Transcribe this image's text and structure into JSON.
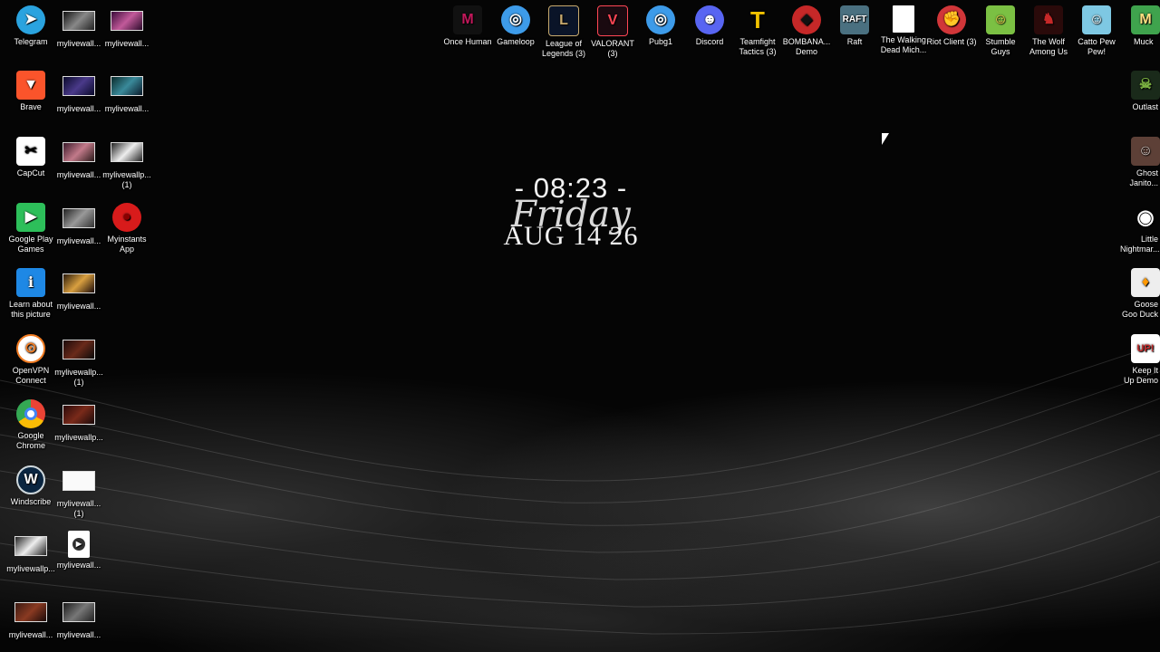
{
  "clock": {
    "time": "- 08:23 -",
    "day": "Friday",
    "date": "AUG 14 26"
  },
  "left_col1": [
    {
      "label": "Telegram",
      "icon": "telegram-icon",
      "color": "#2aa3df"
    },
    {
      "label": "Brave",
      "icon": "brave-lion-icon",
      "color": "#fb542b"
    },
    {
      "label": "CapCut",
      "icon": "capcut-icon",
      "color": "#ffffff"
    },
    {
      "label": "Google Play Games",
      "icon": "play-games-icon",
      "color": "#2dbf5a"
    },
    {
      "label": "Learn about this picture",
      "icon": "info-icon",
      "color": "#1e88e5"
    },
    {
      "label": "OpenVPN Connect",
      "icon": "openvpn-icon",
      "color": "#f07b22"
    },
    {
      "label": "Google Chrome",
      "icon": "chrome-icon",
      "color": "#4285f4"
    },
    {
      "label": "Windscribe",
      "icon": "windscribe-icon",
      "color": "#0a2540"
    },
    {
      "label": "mylivewallp...",
      "icon": "video-file-icon",
      "color": "#444444"
    },
    {
      "label": "mylivewall...",
      "icon": "video-file-icon",
      "color": "#553322"
    }
  ],
  "left_col2": [
    {
      "label": "mylivewall...",
      "icon": "video-file-icon"
    },
    {
      "label": "mylivewall...",
      "icon": "video-file-icon"
    },
    {
      "label": "mylivewall...",
      "icon": "video-file-icon"
    },
    {
      "label": "mylivewall...",
      "icon": "video-file-icon"
    },
    {
      "label": "mylivewall...",
      "icon": "video-file-icon"
    },
    {
      "label": "mylivewallp... (1)",
      "icon": "video-file-icon"
    },
    {
      "label": "mylivewallp...",
      "icon": "video-file-icon"
    },
    {
      "label": "mylivewall... (1)",
      "icon": "video-file-icon"
    },
    {
      "label": "mylivewall...",
      "icon": "media-player-icon"
    },
    {
      "label": "mylivewall...",
      "icon": "video-file-icon"
    }
  ],
  "left_col3": [
    {
      "label": "mylivewall...",
      "icon": "video-file-icon"
    },
    {
      "label": "mylivewall...",
      "icon": "video-file-icon"
    },
    {
      "label": "mylivewallp... (1)",
      "icon": "video-file-icon"
    },
    {
      "label": "Myinstants App",
      "icon": "myinstants-icon",
      "color": "#d81b1b"
    }
  ],
  "top_row": [
    {
      "label": "Once Human",
      "icon": "once-human-icon",
      "color": "#c2185b"
    },
    {
      "label": "Gameloop",
      "icon": "gameloop-icon",
      "color": "#3d9be9"
    },
    {
      "label": "League of Legends (3)",
      "icon": "league-icon",
      "color": "#c8aa6e"
    },
    {
      "label": "VALORANT (3)",
      "icon": "valorant-icon",
      "color": "#ff4655"
    },
    {
      "label": "Pubg1",
      "icon": "pubg-icon",
      "color": "#3d9be9"
    },
    {
      "label": "Discord",
      "icon": "discord-icon",
      "color": "#5865f2"
    },
    {
      "label": "Teamfight Tactics (3)",
      "icon": "tft-icon",
      "color": "#f2c200"
    },
    {
      "label": "BOMBANA... Demo",
      "icon": "bombana-icon",
      "color": "#c62828"
    },
    {
      "label": "Raft",
      "icon": "raft-icon",
      "color": "#4a7080"
    },
    {
      "label": "The Walking Dead Mich...",
      "icon": "file-icon",
      "color": "#ffffff"
    },
    {
      "label": "Riot Client (3)",
      "icon": "riot-client-icon",
      "color": "#d13639"
    },
    {
      "label": "Stumble Guys",
      "icon": "stumble-guys-icon",
      "color": "#7bc043"
    },
    {
      "label": "The Wolf Among Us",
      "icon": "wolf-among-us-icon",
      "color": "#8b1a1a"
    },
    {
      "label": "Catto Pew Pew!",
      "icon": "catto-pew-icon",
      "color": "#7ec8e3"
    },
    {
      "label": "Muck",
      "icon": "muck-icon",
      "color": "#3fa34d"
    }
  ],
  "right_col": [
    {
      "label": "Outlast",
      "icon": "outlast-icon",
      "color": "#2e4d2e"
    },
    {
      "label": "Ghost Janito...",
      "icon": "ghost-janitor-icon",
      "color": "#8d6e63"
    },
    {
      "label": "Little Nightmar...",
      "icon": "eye-icon",
      "color": "#ffffff"
    },
    {
      "label": "Goose Goo Duck",
      "icon": "goose-icon",
      "color": "#eeeeee"
    },
    {
      "label": "Keep It Up Demo",
      "icon": "keep-it-up-icon",
      "color": "#ffffff"
    }
  ],
  "glyphs": {
    "telegram": "➤",
    "brave": "▼",
    "capcut": "✂",
    "play": "▶",
    "info": "i",
    "vpn": "⊙",
    "chrome": "◉",
    "windscribe": "W",
    "media": "▶",
    "myinstants": "●",
    "once": "M",
    "gameloop": "◎",
    "league": "L",
    "valorant": "V",
    "pubg": "◎",
    "discord": "☻",
    "tft": "T",
    "bombana": "◆",
    "raft": "RAFT",
    "riot": "✊",
    "stumble": "☺",
    "wolf": "♞",
    "catto": "☺",
    "muck": "M",
    "outlast": "☠",
    "ghost": "☺",
    "eye": "◉",
    "goose": "♦",
    "keepitup": "UP!",
    "arrow": "↗"
  }
}
